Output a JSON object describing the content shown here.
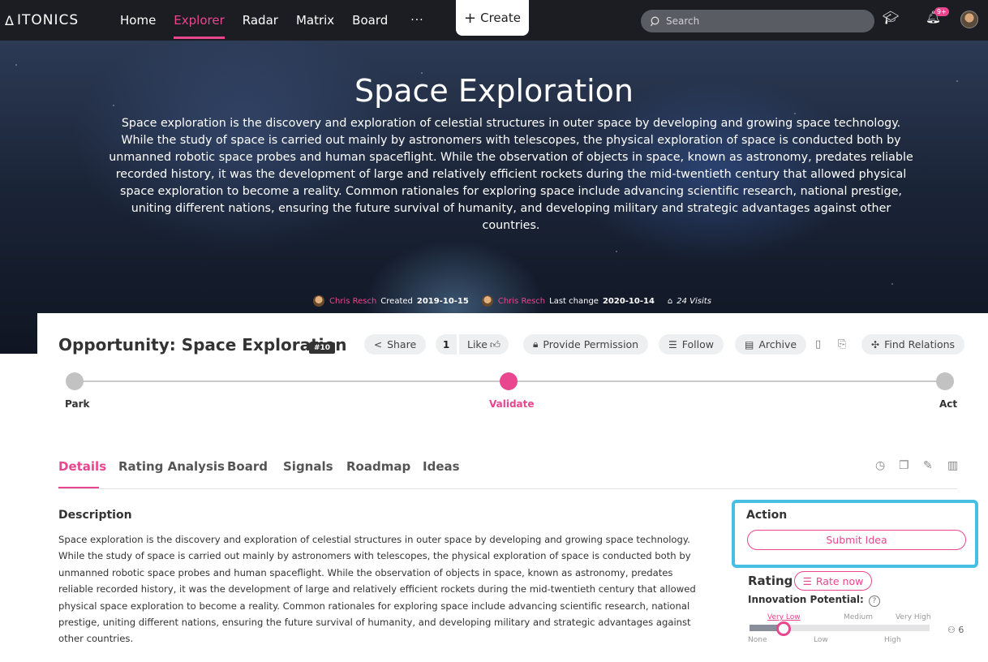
{
  "nav": {
    "logo": "ITONICS",
    "items": [
      "Home",
      "Explorer",
      "Radar",
      "Matrix",
      "Board"
    ],
    "more": "···",
    "create": "Create",
    "search_placeholder": "Search",
    "notifications_badge": "9+"
  },
  "hero": {
    "title": "Space Exploration",
    "description": "Space exploration is the discovery and exploration of celestial structures in outer space by developing and growing space technology. While the study of space is carried out mainly by astronomers with telescopes, the physical exploration of space is conducted both by unmanned robotic space probes and human spaceflight. While the observation of objects in space, known as astronomy, predates reliable recorded history, it was the development of large and relatively efficient rockets during the mid-twentieth century that allowed physical space exploration to become a reality. Common rationales for exploring space include advancing scientific research, national prestige, uniting different nations, ensuring the future survival of humanity, and developing military and strategic advantages against other countries.",
    "author": "Chris Resch",
    "created_label": "Created",
    "created_date": "2019-10-15",
    "editor": "Chris Resch",
    "last_change_label": "Last change",
    "last_change_date": "2020-10-14",
    "visits": "24 Visits"
  },
  "header": {
    "title": "Opportunity: Space Exploration",
    "id_badge": "#10",
    "share": "Share",
    "like_count": "1",
    "like": "Like",
    "provide_permission": "Provide Permission",
    "follow": "Follow",
    "archive": "Archive",
    "find_relations": "Find Relations"
  },
  "stages": {
    "items": [
      "Park",
      "Validate",
      "Act"
    ],
    "active_index": 1
  },
  "tabs": [
    "Details",
    "Rating Analysis",
    "Board",
    "Signals",
    "Roadmap",
    "Ideas"
  ],
  "description": {
    "heading": "Description",
    "body": "Space exploration is the discovery and exploration of celestial structures in outer space by developing and growing space technology. While the study of space is carried out mainly by astronomers with telescopes, the physical exploration of space is conducted both by unmanned robotic space probes and human spaceflight. While the observation of objects in space, known as astronomy, predates reliable recorded history, it was the development of large and relatively efficient rockets during the mid-twentieth century that allowed physical space exploration to become a reality. Common rationales for exploring space include advancing scientific research, national prestige, uniting different nations, ensuring the future survival of humanity, and developing military and strategic advantages against other countries."
  },
  "action": {
    "heading": "Action",
    "submit": "Submit Idea"
  },
  "rating": {
    "heading": "Rating",
    "rate_now": "Rate now",
    "criterion": "Innovation Potential:",
    "scale_top": [
      "Very Low",
      "Medium",
      "Very High"
    ],
    "scale_bottom": [
      "None",
      "Low",
      "High"
    ],
    "selected": "Very Low",
    "level_fraction": 0.2,
    "votes": "6"
  },
  "colors": {
    "accent": "#e8468e",
    "highlight": "#46bfe3",
    "nav_bg": "#1c1d23"
  }
}
